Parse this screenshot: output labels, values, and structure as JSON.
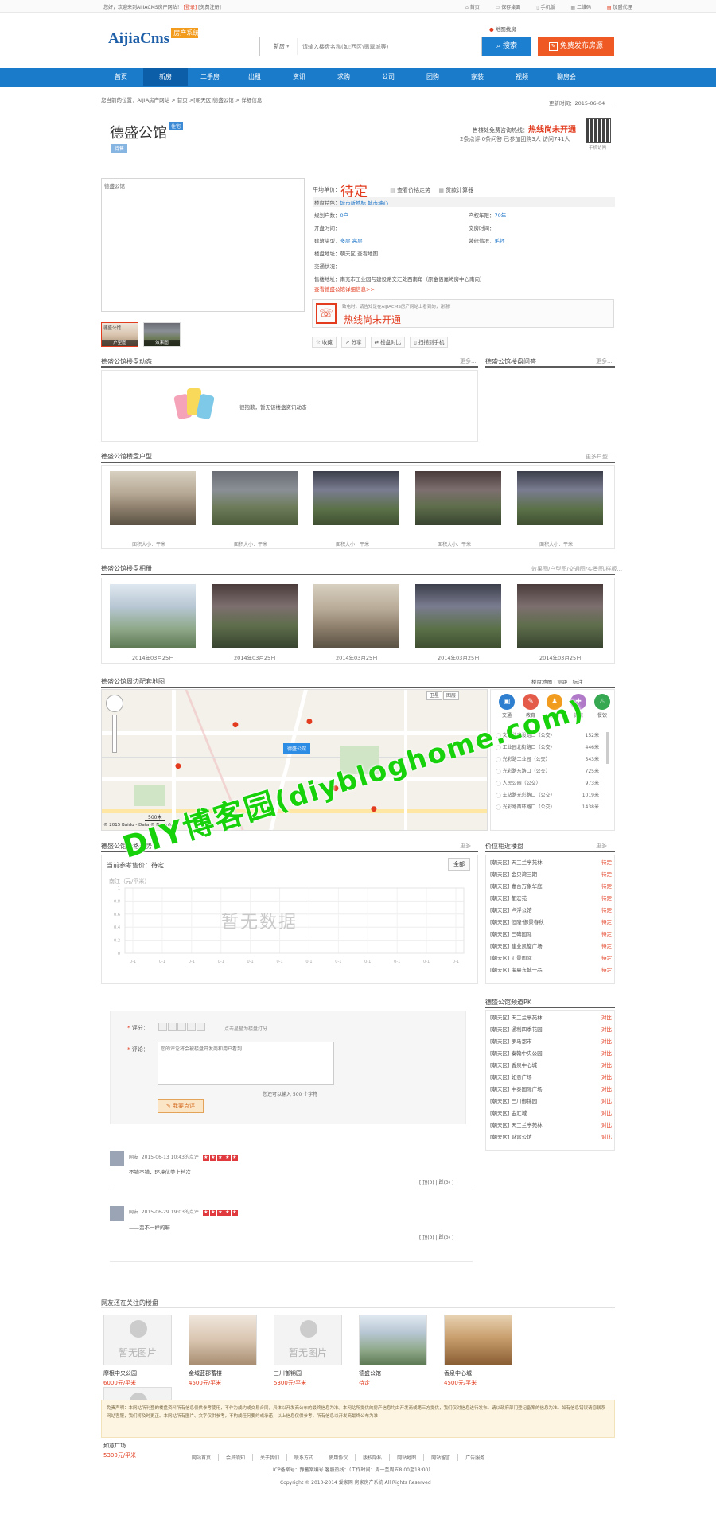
{
  "topbar": {
    "welcome": "您好，欢迎来到AIJIACMS房产网站！",
    "login": "[登录]",
    "register": "[免费注册]",
    "links": [
      "首页",
      "保存桌面",
      "手机版",
      "二维码",
      "加盟代理"
    ]
  },
  "header": {
    "logo_main": "AijiaCms",
    "logo_badge": "房产系统",
    "map_link": "地图找房",
    "search_select": "新房",
    "search_placeholder": "请输入楼盘名称(如:西区\\翡翠城等)",
    "search_btn": "搜索",
    "publish_btn": "免费发布房源"
  },
  "nav": {
    "items": [
      "首页",
      "新房",
      "二手房",
      "出租",
      "资讯",
      "求购",
      "公司",
      "团购",
      "家装",
      "视频",
      "聊房会"
    ],
    "active": "新房"
  },
  "breadcrumb": {
    "prefix": "您当前的位置：",
    "path": "AIJIA房产网站 > 首页 >[朝天区]德盛公馆 > 详细信息",
    "update_time": "更新时间：2015-06-04"
  },
  "property": {
    "name": "德盛公馆",
    "tag": "住宅",
    "status_badge": "待售",
    "hotline_label": "售楼处免费咨询热线：",
    "hotline_value": "热线尚未开通",
    "stats": "2条点评 0条问答 已参加团购3人 访问741人",
    "qr_label": "手机访问",
    "image_alt": "德盛公馆",
    "price_label": "平均单价：",
    "price_value": "待定",
    "price_trend": "查看价格走势",
    "loan_calc": "贷款计算器",
    "thumbs": [
      "户型图",
      "效果图"
    ]
  },
  "info": {
    "rows": [
      {
        "l": "楼盘特色：",
        "v": "城市新地标 城市轴心",
        "l2": "",
        "v2": ""
      },
      {
        "l": "规划户数：",
        "v": "0户",
        "l2": "产权年限：",
        "v2": "70年"
      },
      {
        "l": "开盘时间：",
        "v": "",
        "l2": "交房时间：",
        "v2": ""
      },
      {
        "l": "建筑类型：",
        "v": "多层 高层",
        "l2": "装修情况：",
        "v2": "毛坯"
      },
      {
        "l": "楼盘地址：",
        "v": "朝天区  查看地图",
        "l2": "",
        "v2": ""
      },
      {
        "l": "交通状况：",
        "v": "",
        "l2": "",
        "v2": ""
      },
      {
        "l": "售楼地址：",
        "v": "南充市工业园与建设路交汇处西南角（原金佰嘉烤房中心南向）",
        "l2": "",
        "v2": ""
      }
    ],
    "more_link": "查看德盛公馆详细信息>>",
    "contact_tip": "致电时，请告知是在AIJIACMS房产网站上看到的，谢谢！",
    "contact_hotline": "热线尚未开通",
    "actions": [
      "收藏",
      "分享",
      "楼盘对比",
      "扫描到手机"
    ]
  },
  "sections": {
    "news": {
      "title": "德盛公馆楼盘动态",
      "more": "更多...",
      "empty": "很抱歉，暂无该楼盘资讯动态"
    },
    "qa": {
      "title": "德盛公馆楼盘问答",
      "more": "更多..."
    },
    "layout": {
      "title": "德盛公馆楼盘户型",
      "more": "更多户型...",
      "caption": "面积大小：平米"
    },
    "album": {
      "title": "德盛公馆楼盘相册",
      "more": "效果图/户型图/交通图/实景图/样板...",
      "captions": [
        "2014年03月25日",
        "2014年03月25日",
        "2014年03月25日",
        "2014年03月25日",
        "2014年03月25日"
      ]
    },
    "map": {
      "title": "德盛公馆周边配套地图",
      "map_tools": [
        "卫星",
        "图层"
      ],
      "ext_tools": [
        "楼盘地图",
        "测距",
        "标注"
      ],
      "marker": "德盛公馆",
      "scale": "500米",
      "copyright": "© 2015 Baidu - Data © NavInfo"
    },
    "price": {
      "title": "德盛公馆价格走势",
      "more": "更多...",
      "current_label": "当前参考售价：",
      "current_value": "待定",
      "range": "全部",
      "unit_label": "南江（元/平米）",
      "empty": "暂无数据",
      "y_ticks": [
        "1",
        "0.8",
        "0.6",
        "0.4",
        "0.2",
        "0"
      ],
      "x_ticks": [
        "0-1",
        "0-1",
        "0-1",
        "0-1",
        "0-1",
        "0-1",
        "0-1",
        "0-1",
        "0-1",
        "0-1",
        "0-1",
        "0-1"
      ]
    },
    "nearby": {
      "title": "价位相近楼盘",
      "more": "更多..."
    },
    "pk": {
      "title": "德盛公馆频道PK"
    },
    "watching": {
      "title": "网友还在关注的楼盘"
    }
  },
  "poi": {
    "tabs": [
      "交通",
      "教育",
      "生活",
      "健康",
      "餐饮"
    ],
    "tab_colors": [
      "#2e7fd0",
      "#e45b49",
      "#f29c1f",
      "#b07ac9",
      "#36a852"
    ],
    "items": [
      {
        "name": "文化路建设路口（公交）",
        "dist": "152米"
      },
      {
        "name": "工业园北街路口（公交）",
        "dist": "446米"
      },
      {
        "name": "光彩路工业园（公交）",
        "dist": "543米"
      },
      {
        "name": "光彩路东路口（公交）",
        "dist": "725米"
      },
      {
        "name": "人民公园（公交）",
        "dist": "973米"
      },
      {
        "name": "车站路光彩路口（公交）",
        "dist": "1019米"
      },
      {
        "name": "光彩路西环路口（公交）",
        "dist": "1438米"
      }
    ]
  },
  "nearby_list": [
    {
      "name": "[朝天区] 天工兰亭苑林",
      "price": "待定"
    },
    {
      "name": "[朝天区] 金贝湾三期",
      "price": "待定"
    },
    {
      "name": "[朝天区] 嘉合万象华庭",
      "price": "待定"
    },
    {
      "name": "[朝天区] 都宏苑",
      "price": "待定"
    },
    {
      "name": "[朝天区] 卢浮公馆",
      "price": "待定"
    },
    {
      "name": "[朝天区] 恒隆·御景春秋",
      "price": "待定"
    },
    {
      "name": "[朝天区] 三碑国际",
      "price": "待定"
    },
    {
      "name": "[朝天区] 建业凯旋广场",
      "price": "待定"
    },
    {
      "name": "[朝天区] 汇景国际",
      "price": "待定"
    },
    {
      "name": "[朝天区] 海晨东城一品",
      "price": "待定"
    }
  ],
  "pk_list": [
    {
      "name": "[朝天区] 天工兰亭苑林",
      "action": "对比"
    },
    {
      "name": "[朝天区] 通利四季花园",
      "action": "对比"
    },
    {
      "name": "[朝天区] 罗马都市",
      "action": "对比"
    },
    {
      "name": "[朝天区] 秦翰中央公园",
      "action": "对比"
    },
    {
      "name": "[朝天区] 香泉中心城",
      "action": "对比"
    },
    {
      "name": "[朝天区] 如意广场",
      "action": "对比"
    },
    {
      "name": "[朝天区] 中泰国际广场",
      "action": "对比"
    },
    {
      "name": "[朝天区] 三川御锦园",
      "action": "对比"
    },
    {
      "name": "[朝天区] 金汇城",
      "action": "对比"
    },
    {
      "name": "[朝天区] 天工兰亭苑林",
      "action": "对比"
    },
    {
      "name": "[朝天区] 财富公馆",
      "action": "对比"
    }
  ],
  "review": {
    "rating_label": "评分：",
    "rating_hint": "点击星星为楼盘打分",
    "comment_label": "评论：",
    "comment_placeholder": "您的评论将会被楼盘开发商和用户看到",
    "limit_text": "您还可以输入 500 个字符",
    "submit": "我要点评"
  },
  "comments": [
    {
      "user": "网友",
      "meta": "2015-06-13 10:43的点评",
      "text": "不错不错，环境优美上档次",
      "footer": "[ 顶(0) | 踩(0) ]"
    },
    {
      "user": "网友",
      "meta": "2015-06-29 19:03的点评",
      "text": "——蛮不一样的嘛",
      "footer": "[ 顶(0) | 踩(0) ]"
    }
  ],
  "watching_list": [
    {
      "name": "摩根中央公园",
      "price": "6000元/平米",
      "img": "暂无图片"
    },
    {
      "name": "金域蓝郡蓄楼",
      "price": "4500元/平米",
      "img": ""
    },
    {
      "name": "三川御锦园",
      "price": "5300元/平米",
      "img": "暂无图片"
    },
    {
      "name": "德盛公馆",
      "price": "待定",
      "img": ""
    },
    {
      "name": "香泉中心城",
      "price": "4500元/平米",
      "img": ""
    },
    {
      "name": "如意广场",
      "price": "5300元/平米",
      "img": "暂无图片"
    }
  ],
  "disclaimer": "免责声明：本网站所刊登的楼盘资料所有信息仅供参考使用，不作为成约或交易合同，具体以开发商公布的最终信息为准。本网站所提供的房产信息均由开发商或第三方提供，我们仅对信息进行发布。请以政府部门登记备案的信息为准。如有信息错误请您联系网站客服，我们将及时更正。本网站所有图片、文字仅供参考，不构成任何要约或承诺，以上信息仅供参考，所有信息以开发商最终公布为准！",
  "footer": {
    "links": [
      "网站首页",
      "会员须知",
      "关于我们",
      "联系方式",
      "使用协议",
      "版权隐私",
      "网站地图",
      "网站留言",
      "广告服务"
    ],
    "icp": "ICP备案号：豫蓄案编号  客服热线：（工作时间：周一至周五8:00至18:00）",
    "copyright": "Copyright © 2010-2014 爱家网·房家房产系统 All Rights Reserved"
  },
  "watermark": {
    "cn": "DIY博客园",
    "url": "(diybloghome.com)"
  }
}
